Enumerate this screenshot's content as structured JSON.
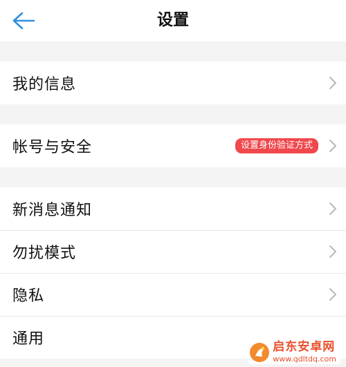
{
  "header": {
    "back_icon": "arrow-left-icon",
    "title": "设置"
  },
  "colors": {
    "accent": "#2f8fe0",
    "badge_bg": "#f0484d",
    "watermark": "#e8502a"
  },
  "sections": [
    {
      "items": [
        {
          "label": "我的信息"
        }
      ]
    },
    {
      "items": [
        {
          "label": "帐号与安全",
          "badge": "设置身份验证方式"
        }
      ]
    },
    {
      "items": [
        {
          "label": "新消息通知"
        },
        {
          "label": "勿扰模式"
        },
        {
          "label": "隐私"
        },
        {
          "label": "通用"
        }
      ]
    }
  ],
  "watermark": {
    "title": "启东安卓网",
    "url": "www.qdltdq.com"
  }
}
